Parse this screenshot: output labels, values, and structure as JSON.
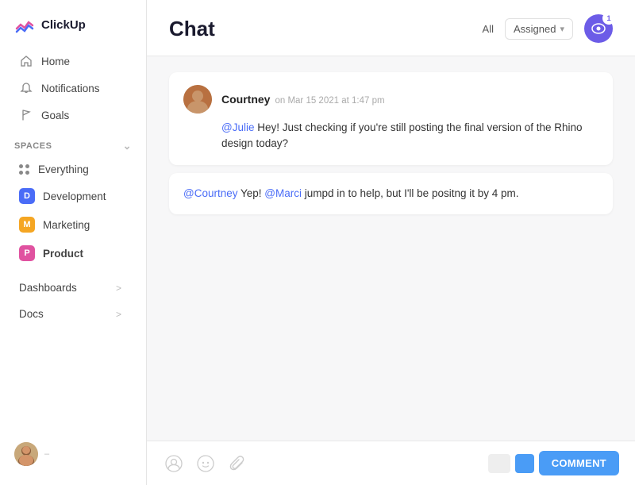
{
  "app": {
    "logo_text": "ClickUp"
  },
  "sidebar": {
    "nav_items": [
      {
        "id": "home",
        "label": "Home",
        "icon": "home-icon"
      },
      {
        "id": "notifications",
        "label": "Notifications",
        "icon": "bell-icon"
      },
      {
        "id": "goals",
        "label": "Goals",
        "icon": "flag-icon"
      }
    ],
    "spaces_label": "Spaces",
    "spaces": [
      {
        "id": "everything",
        "label": "Everything",
        "type": "dots"
      },
      {
        "id": "development",
        "label": "Development",
        "badge": "D",
        "color": "badge-blue"
      },
      {
        "id": "marketing",
        "label": "Marketing",
        "badge": "M",
        "color": "badge-orange"
      },
      {
        "id": "product",
        "label": "Product",
        "badge": "P",
        "color": "badge-pink",
        "active": true
      }
    ],
    "sections": [
      {
        "id": "dashboards",
        "label": "Dashboards"
      },
      {
        "id": "docs",
        "label": "Docs"
      }
    ]
  },
  "header": {
    "title": "Chat",
    "filter_all": "All",
    "filter_assigned": "Assigned",
    "watch_count": "1"
  },
  "messages": [
    {
      "id": "msg1",
      "author": "Courtney",
      "time": "on Mar 15 2021 at 1:47 pm",
      "text_parts": [
        {
          "type": "mention",
          "text": "@Julie"
        },
        {
          "type": "text",
          "text": " Hey! Just checking if you're still posting the final version of the Rhino design today?"
        }
      ]
    }
  ],
  "reply": {
    "text_parts": [
      {
        "type": "mention",
        "text": "@Courtney"
      },
      {
        "type": "text",
        "text": " Yep! "
      },
      {
        "type": "mention",
        "text": "@Marci"
      },
      {
        "type": "text",
        "text": " jumpd in to help, but I'll be positng it by 4 pm."
      }
    ]
  },
  "compose": {
    "comment_btn": "COMMENT"
  }
}
